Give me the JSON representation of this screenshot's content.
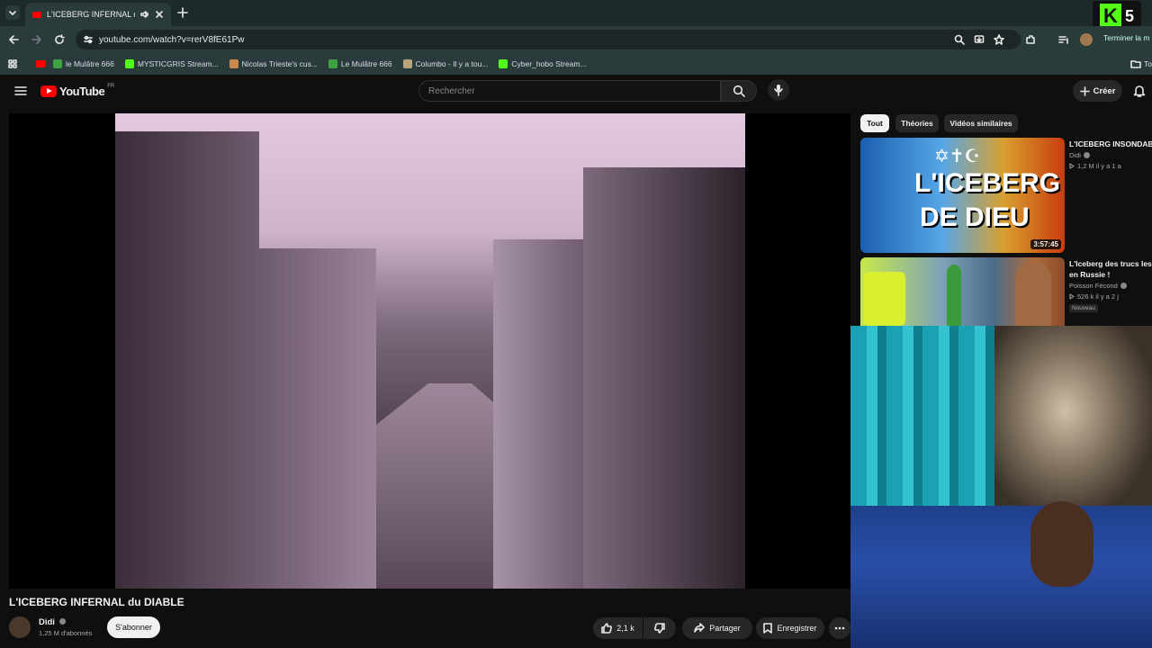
{
  "browser": {
    "tab_title": "L'ICEBERG INFERNAL du DI",
    "url": "youtube.com/watch?v=rerV8fE61Pw",
    "profile_action": "Terminer la m",
    "bookmarks": [
      {
        "label": "le Mulâtre 666",
        "color": "#3fa13f"
      },
      {
        "label": "MYSTICGRIS Stream...",
        "color": "#53fc18"
      },
      {
        "label": "Nicolas Trieste's cus...",
        "color": "#c98a4a"
      },
      {
        "label": "Le Mulâtre 666",
        "color": "#3fa13f"
      },
      {
        "label": "Columbo - Il y a tou...",
        "color": "#b9a37a"
      },
      {
        "label": "Cyber_hobo Stream...",
        "color": "#53fc18"
      }
    ],
    "bookmarks_overflow": "To"
  },
  "overlay_badge": {
    "letter": "K",
    "number": "5"
  },
  "youtube": {
    "logo": "YouTube",
    "region": "FR",
    "search_placeholder": "Rechercher",
    "create_label": "Créer"
  },
  "video": {
    "title": "L'ICEBERG INFERNAL du DIABLE",
    "channel": "Didi",
    "subscribers": "1,25 M d'abonnés",
    "subscribe_label": "S'abonner",
    "likes": "2,1 k",
    "share_label": "Partager",
    "save_label": "Enregistrer"
  },
  "sidebar": {
    "chips": [
      "Tout",
      "Théories",
      "Vidéos similaires"
    ],
    "recommendations": [
      {
        "title": "L'ICEBERG INSONDABL",
        "channel": "Didi",
        "meta": "1,2 M  il y a 1 a",
        "duration": "3:57:45",
        "thumb_text_1": "L'ICEBERG",
        "thumb_text_2": "DE DIEU"
      },
      {
        "title": "L'Iceberg des trucs les p",
        "title_line2": "en Russie !",
        "channel": "Poisson Fécond",
        "meta": "526 k  il y a 2 j",
        "badge": "Nouveau"
      }
    ]
  }
}
